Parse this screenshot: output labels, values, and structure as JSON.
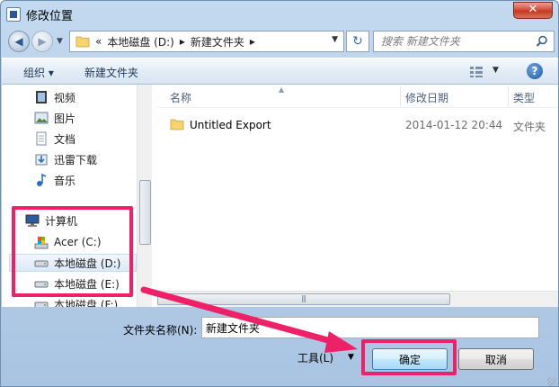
{
  "window": {
    "title": "修改位置",
    "close_glyph": "✕"
  },
  "navbar": {
    "back_glyph": "◀",
    "forward_glyph": "▶",
    "address_segments": [
      "«",
      "本地磁盘 (D:)",
      "▸",
      "新建文件夹",
      "▸"
    ],
    "search_placeholder": "搜索 新建文件夹",
    "refresh_glyph": "↻"
  },
  "toolbar": {
    "organize_label": "组织 ▾",
    "new_folder_label": "新建文件夹",
    "help_glyph": "?"
  },
  "nav_pane": {
    "items": [
      {
        "label": "视频",
        "icon": "video-library-icon"
      },
      {
        "label": "图片",
        "icon": "pictures-library-icon"
      },
      {
        "label": "文档",
        "icon": "documents-library-icon"
      },
      {
        "label": "迅雷下载",
        "icon": "download-folder-icon"
      },
      {
        "label": "音乐",
        "icon": "music-library-icon"
      },
      {
        "label": "计算机",
        "icon": "computer-icon"
      },
      {
        "label": "Acer (C:)",
        "icon": "system-drive-icon"
      },
      {
        "label": "本地磁盘 (D:)",
        "icon": "hard-drive-icon",
        "selected": true
      },
      {
        "label": "本地磁盘 (E:)",
        "icon": "hard-drive-icon"
      },
      {
        "label": "本地磁盘 (F:)",
        "icon": "hard-drive-icon"
      }
    ]
  },
  "file_list": {
    "columns": [
      "名称",
      "修改日期",
      "类型"
    ],
    "rows": [
      {
        "name": "Untitled Export",
        "date": "2014-01-12 20:44",
        "type": "文件夹",
        "icon": "folder-icon"
      }
    ]
  },
  "bottom": {
    "folder_name_label": "文件夹名称(N):",
    "folder_name_value": "新建文件夹",
    "tools_label": "工具(L)",
    "ok_label": "确定",
    "cancel_label": "取消"
  },
  "annotations": {
    "highlight_color": "#ee2068"
  }
}
